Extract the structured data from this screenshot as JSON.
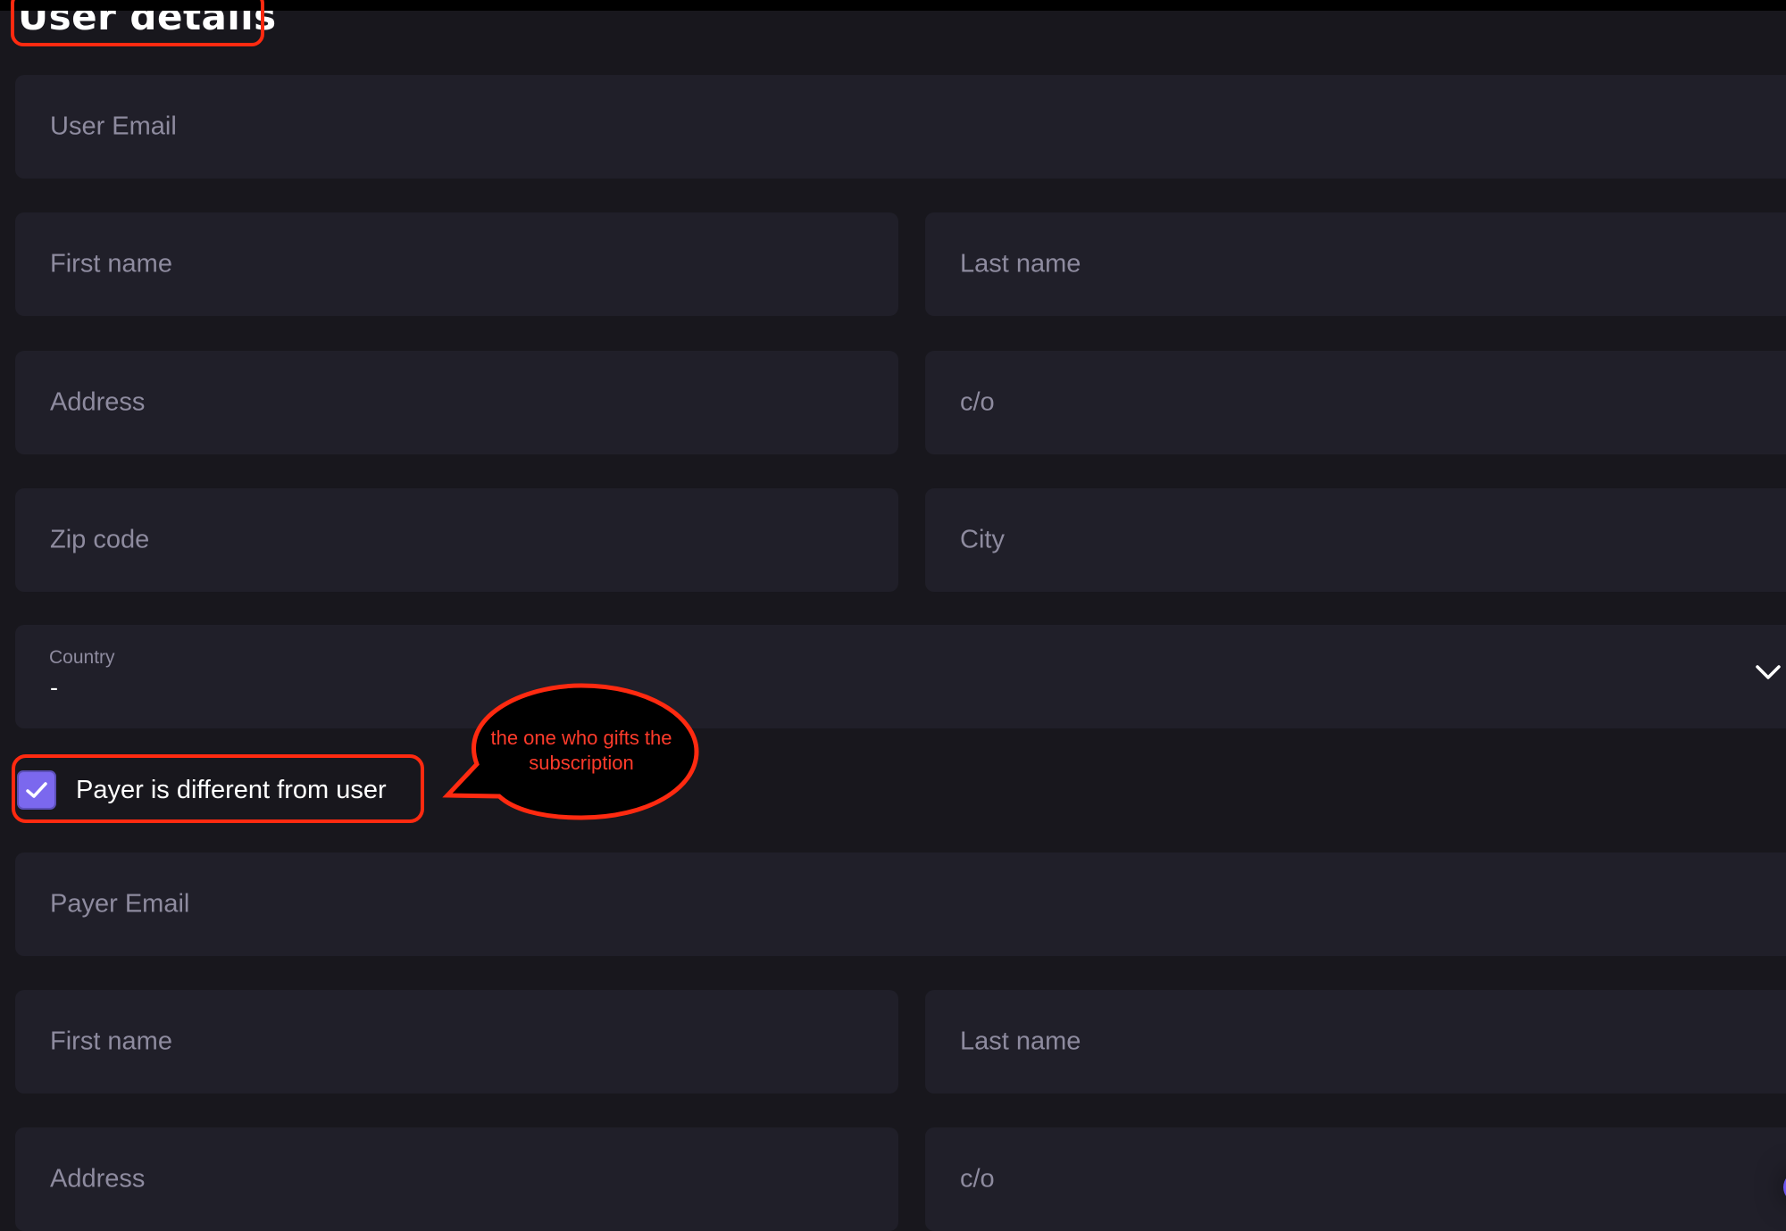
{
  "page": {
    "title": "User details"
  },
  "user_section": {
    "email": {
      "placeholder": "User Email",
      "value": ""
    },
    "first_name": {
      "placeholder": "First name",
      "value": ""
    },
    "last_name": {
      "placeholder": "Last name",
      "value": ""
    },
    "address": {
      "placeholder": "Address",
      "value": ""
    },
    "care_of": {
      "placeholder": "c/o",
      "value": ""
    },
    "zip_code": {
      "placeholder": "Zip code",
      "value": ""
    },
    "city": {
      "placeholder": "City",
      "value": ""
    },
    "country": {
      "label": "Country",
      "selected": "-",
      "icon": "chevron-down-icon"
    }
  },
  "payer_toggle": {
    "label": "Payer is different from user",
    "checked": true,
    "icon": "check-icon"
  },
  "payer_section": {
    "email": {
      "placeholder": "Payer Email",
      "value": ""
    },
    "first_name": {
      "placeholder": "First name",
      "value": ""
    },
    "last_name": {
      "placeholder": "Last name",
      "value": ""
    },
    "address": {
      "placeholder": "Address",
      "value": ""
    },
    "care_of": {
      "placeholder": "c/o",
      "value": ""
    }
  },
  "annotations": {
    "callout_text": "the one who gifts the subscription",
    "color": "#ff2a10"
  },
  "colors": {
    "background": "#18171d",
    "field": "#201f29",
    "placeholder": "#8e8b9f",
    "accent": "#7b68ee"
  }
}
